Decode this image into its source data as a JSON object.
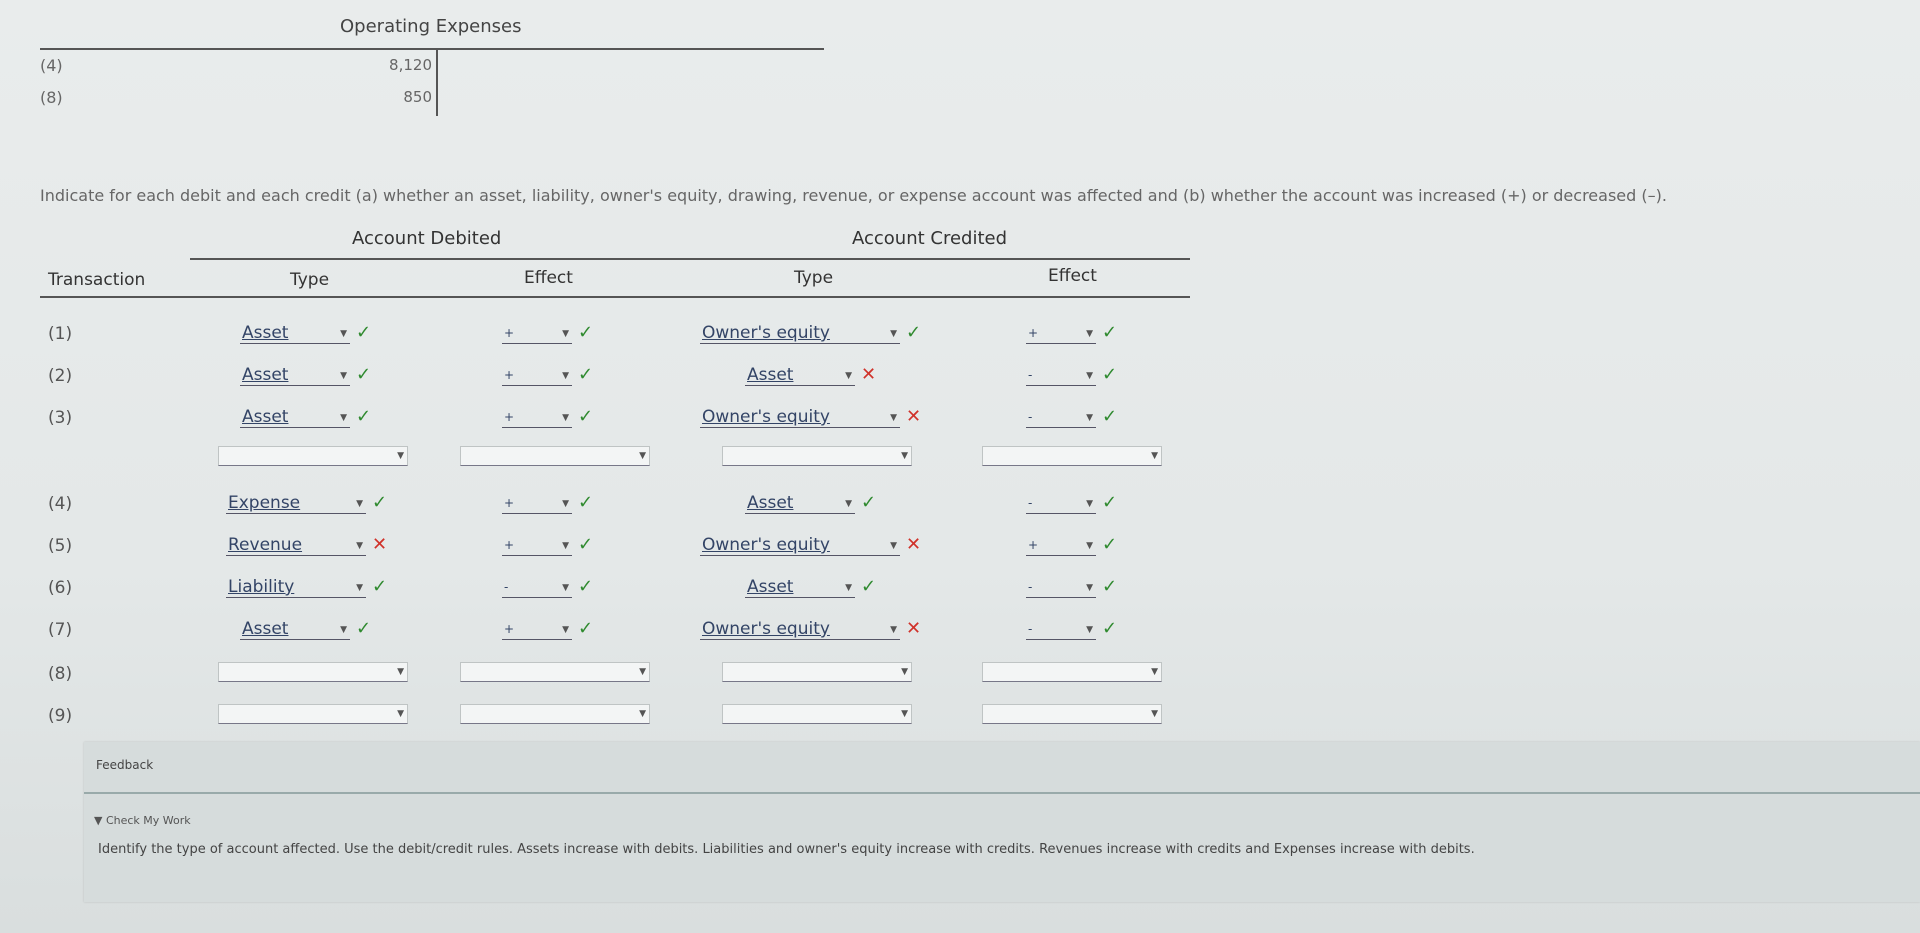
{
  "t_account": {
    "title": "Operating Expenses",
    "rows": [
      {
        "label": "(4)",
        "value": "8,120"
      },
      {
        "label": "(8)",
        "value": "850"
      }
    ]
  },
  "instructions": "Indicate for each debit and each credit (a) whether an asset, liability, owner's equity, drawing, revenue, or expense account was affected and (b) whether the account was increased (+) or decreased (–).",
  "table": {
    "group_headers": {
      "debited": "Account Debited",
      "credited": "Account Credited"
    },
    "columns": {
      "transaction": "Transaction",
      "type": "Type",
      "effect": "Effect",
      "type2": "Type",
      "effect2": "Effect"
    },
    "rows": [
      {
        "label": "(1)",
        "debit_type": "Asset",
        "debit_type_mark": "check",
        "debit_effect": "+",
        "debit_effect_mark": "check",
        "credit_type": "Owner's equity",
        "credit_type_mark": "check",
        "credit_effect": "+",
        "credit_effect_mark": "check"
      },
      {
        "label": "(2)",
        "debit_type": "Asset",
        "debit_type_mark": "check",
        "debit_effect": "+",
        "debit_effect_mark": "check",
        "credit_type": "Asset",
        "credit_type_mark": "x",
        "credit_effect": "-",
        "credit_effect_mark": "check"
      },
      {
        "label": "(3)",
        "debit_type": "Asset",
        "debit_type_mark": "check",
        "debit_effect": "+",
        "debit_effect_mark": "check",
        "credit_type": "Owner's equity",
        "credit_type_mark": "x",
        "credit_effect": "-",
        "credit_effect_mark": "check"
      },
      {
        "label": "",
        "debit_type": "",
        "debit_effect": "",
        "credit_type": "",
        "credit_effect": ""
      },
      {
        "label": "(4)",
        "debit_type": "Expense",
        "debit_type_mark": "check",
        "debit_effect": "+",
        "debit_effect_mark": "check",
        "credit_type": "Asset",
        "credit_type_mark": "check",
        "credit_effect": "-",
        "credit_effect_mark": "check"
      },
      {
        "label": "(5)",
        "debit_type": "Revenue",
        "debit_type_mark": "x",
        "debit_effect": "+",
        "debit_effect_mark": "check",
        "credit_type": "Owner's equity",
        "credit_type_mark": "x",
        "credit_effect": "+",
        "credit_effect_mark": "check"
      },
      {
        "label": "(6)",
        "debit_type": "Liability",
        "debit_type_mark": "check",
        "debit_effect": "-",
        "debit_effect_mark": "check",
        "credit_type": "Asset",
        "credit_type_mark": "check",
        "credit_effect": "-",
        "credit_effect_mark": "check"
      },
      {
        "label": "(7)",
        "debit_type": "Asset",
        "debit_type_mark": "check",
        "debit_effect": "+",
        "debit_effect_mark": "check",
        "credit_type": "Owner's equity",
        "credit_type_mark": "x",
        "credit_effect": "-",
        "credit_effect_mark": "check"
      },
      {
        "label": "(8)",
        "debit_type": "",
        "debit_effect": "",
        "credit_type": "",
        "credit_effect": ""
      },
      {
        "label": "(9)",
        "debit_type": "",
        "debit_effect": "",
        "credit_type": "",
        "credit_effect": ""
      }
    ]
  },
  "feedback": {
    "title": "Feedback",
    "check_my_work": "▼ Check My Work",
    "text": "Identify the type of account affected. Use the debit/credit rules. Assets increase with debits. Liabilities and owner's equity increase with credits. Revenues increase with credits and Expenses increase with debits."
  },
  "colors": {
    "check": "#2f8a2f",
    "x": "#d0322a"
  }
}
